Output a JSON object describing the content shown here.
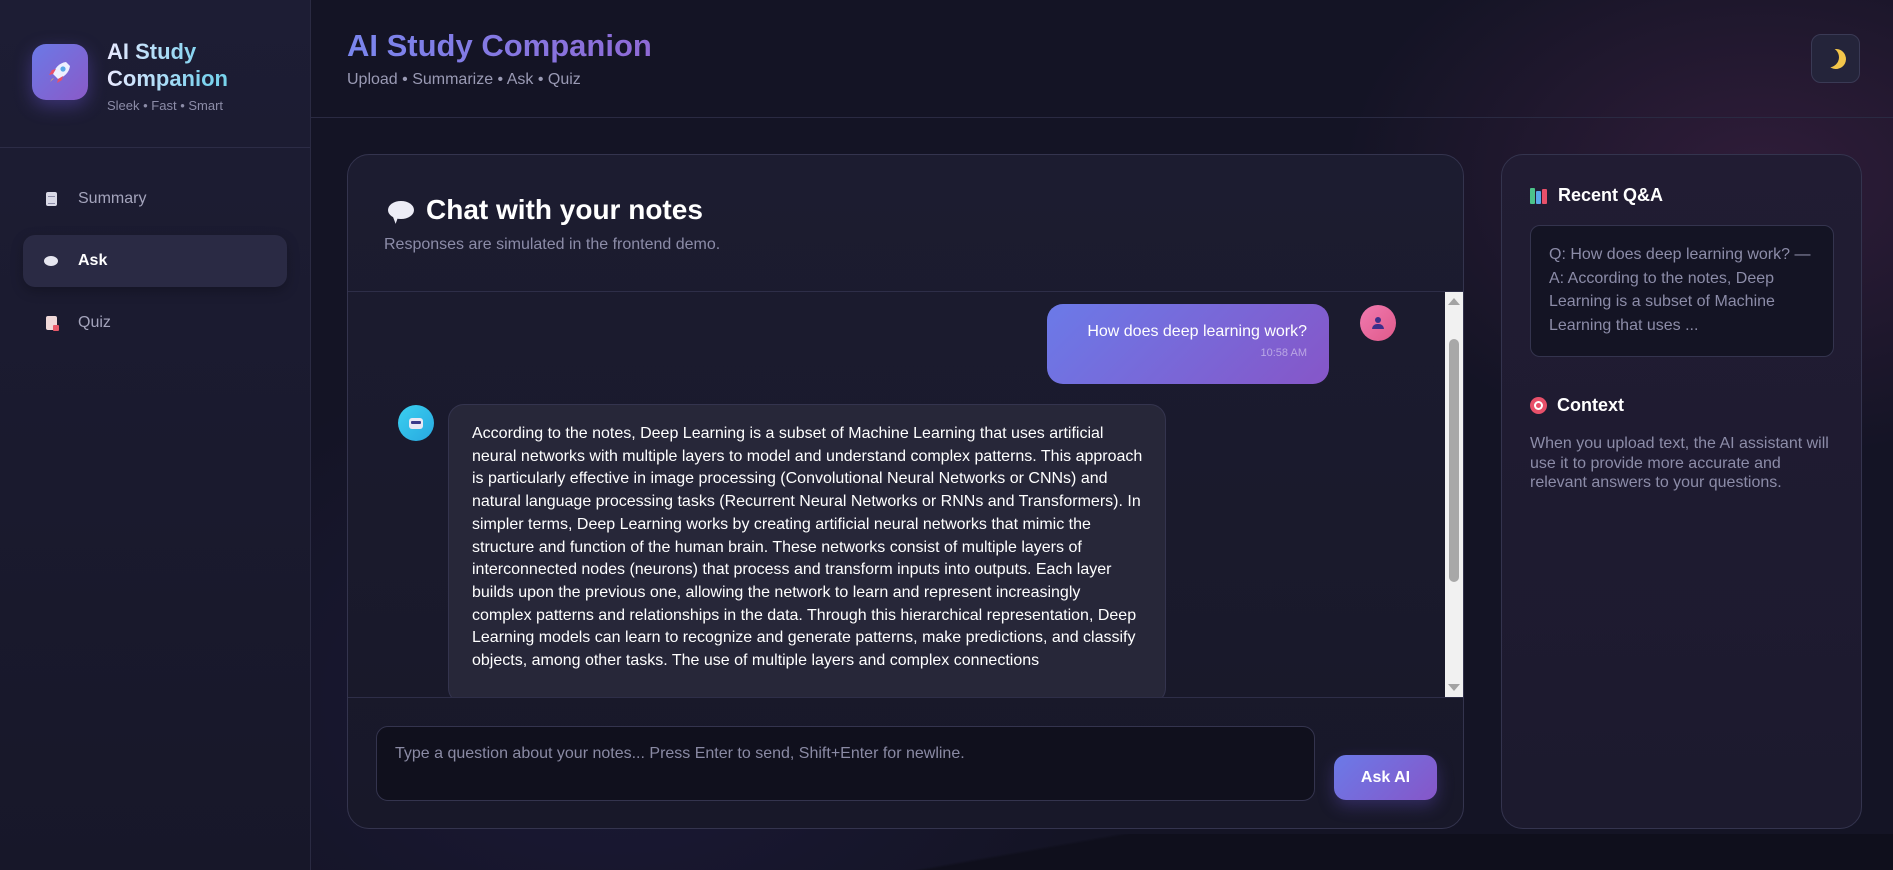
{
  "brand": {
    "logo_icon": "rocket-icon",
    "title": "AI Study Companion",
    "subtitle": "Sleek • Fast • Smart"
  },
  "sidebar": {
    "items": [
      {
        "label": "Summary",
        "icon": "document-icon",
        "active": false
      },
      {
        "label": "Ask",
        "icon": "speech-bubble-icon",
        "active": true
      },
      {
        "label": "Quiz",
        "icon": "quiz-icon",
        "active": false
      }
    ]
  },
  "header": {
    "title": "AI Study Companion",
    "subtitle": "Upload • Summarize • Ask • Quiz",
    "theme_toggle_icon": "moon-icon"
  },
  "chat": {
    "title": "Chat with your notes",
    "description": "Responses are simulated in the frontend demo.",
    "messages": [
      {
        "role": "user",
        "text": "How does deep learning work?",
        "time": "10:58 AM"
      },
      {
        "role": "assistant",
        "text": "According to the notes, Deep Learning is a subset of Machine Learning that uses artificial neural networks with multiple layers to model and understand complex patterns. This approach is particularly effective in image processing (Convolutional Neural Networks or CNNs) and natural language processing tasks (Recurrent Neural Networks or RNNs and Transformers). In simpler terms, Deep Learning works by creating artificial neural networks that mimic the structure and function of the human brain. These networks consist of multiple layers of interconnected nodes (neurons) that process and transform inputs into outputs. Each layer builds upon the previous one, allowing the network to learn and represent increasingly complex patterns and relationships in the data. Through this hierarchical representation, Deep Learning models can learn to recognize and generate patterns, make predictions, and classify objects, among other tasks. The use of multiple layers and complex connections"
      }
    ],
    "input_placeholder": "Type a question about your notes... Press Enter to send, Shift+Enter for newline.",
    "input_value": "",
    "send_label": "Ask AI"
  },
  "side_panel": {
    "recent_title": "Recent Q&A",
    "recent_text": "Q: How does deep learning work? — A: According to the notes, Deep Learning is a subset of Machine Learning that uses ...",
    "context_title": "Context",
    "context_text": "When you upload text, the AI assistant will use it to provide more accurate and relevant answers to your questions."
  },
  "colors": {
    "accent_start": "#6b7ae8",
    "accent_end": "#8656c8",
    "bot_avatar": "#3ad0f0",
    "user_avatar": "#f07ab0",
    "background": "#141425"
  }
}
